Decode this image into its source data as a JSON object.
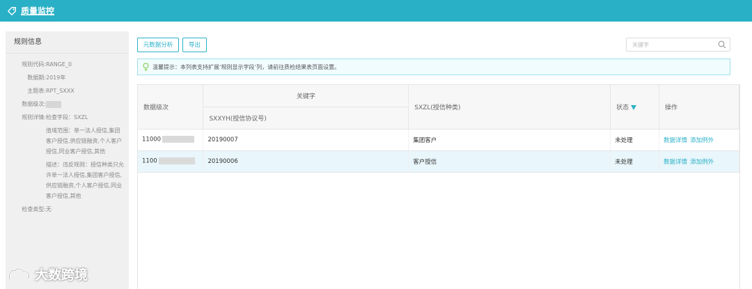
{
  "header": {
    "title": "质量监控",
    "bg": "#2ab0c6"
  },
  "rule_panel": {
    "heading": "规则信息",
    "fields": [
      {
        "k": "规则代码:",
        "v": "RANGE_0"
      },
      {
        "k": "数据期:",
        "v": "2019年"
      },
      {
        "k": "主题表:",
        "v": "RPT_SXXX"
      },
      {
        "k": "数据级次:",
        "v": ""
      },
      {
        "k": "规则详情:",
        "v": "检查字段：SXZL"
      },
      {
        "k": "",
        "v": "值域范围：单一法人授信,集团客户授信,供应链融资,个人客户授信,同业客户授信,其他"
      },
      {
        "k": "",
        "v": "描述：违反规则：授信种类只允许单一法人授信,集团客户授信,供应链融资,个人客户授信,同业客户授信,其他"
      },
      {
        "k": "检查类型:",
        "v": "无"
      }
    ]
  },
  "toolbar": {
    "meta_analysis": "元数据分析",
    "export": "导出"
  },
  "search": {
    "placeholder": "关键字"
  },
  "tip": {
    "text": "温馨提示：本列表支持扩展‘规则显示字段’列，请前往质检结果表页面设置。"
  },
  "table": {
    "headers": {
      "level": "数据级次",
      "keyword_group": "关键字",
      "sxxyh": "SXXYH(授信协议号)",
      "sxzl": "SXZL(授信种类)",
      "status": "状态",
      "action": "操作"
    },
    "rows": [
      {
        "level": "11000",
        "sxxyh": "20190007",
        "sxzl": "集团客户",
        "status": "未处理",
        "detail": "数据详情",
        "exception": "添加例外"
      },
      {
        "level": "1100",
        "sxxyh": "20190006",
        "sxzl": "客户授信",
        "status": "未处理",
        "detail": "数据详情",
        "exception": "添加例外"
      }
    ]
  },
  "watermark": {
    "text": "大数跨境"
  },
  "accent_color": "#2ab0c6"
}
